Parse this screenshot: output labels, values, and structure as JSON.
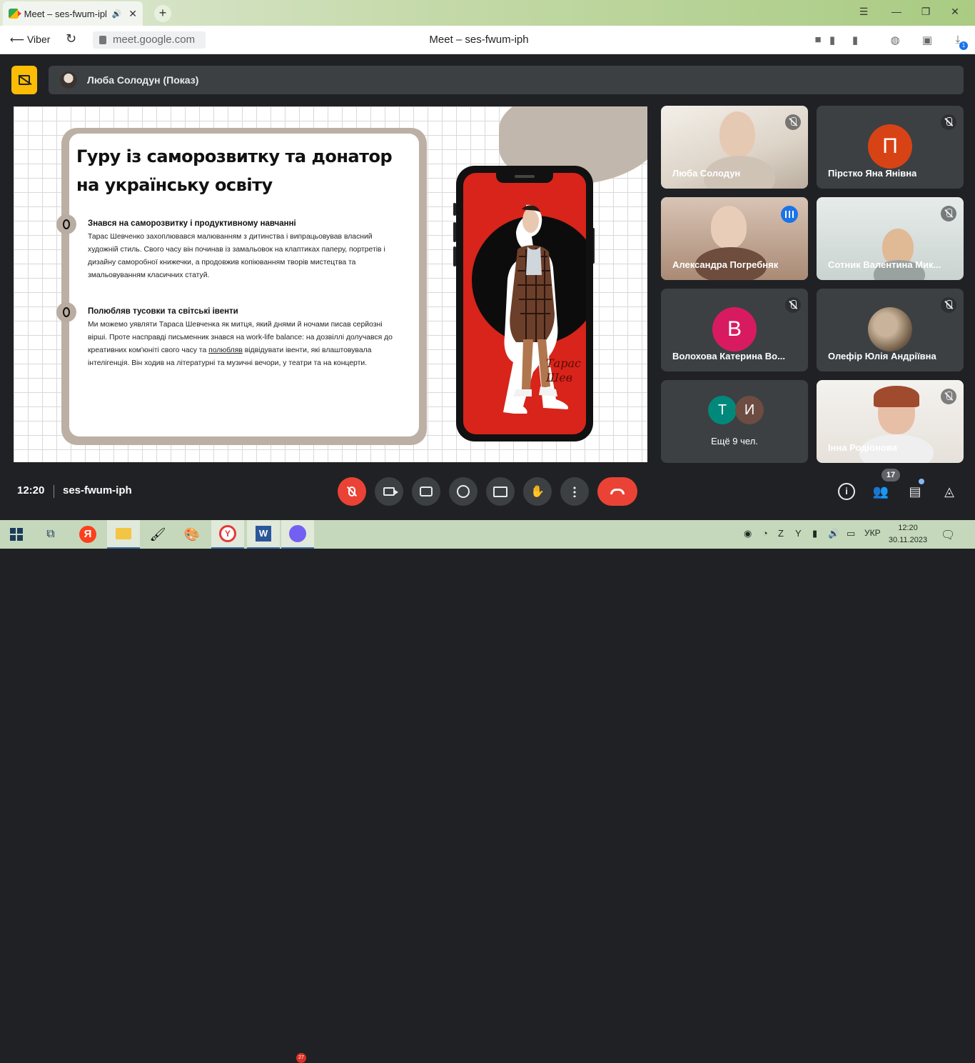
{
  "browser": {
    "tab_title": "Meet – ses-fwum-iph",
    "back_label": "Viber",
    "url": "meet.google.com",
    "page_title": "Meet – ses-fwum-iph",
    "downloads_badge": "1"
  },
  "presenter": {
    "name": "Люба Солодун (Показ)"
  },
  "slide": {
    "title": "Гуру із саморозвитку та донатор на українську освіту",
    "sections": [
      {
        "heading": "Знався на саморозвитку і продуктивному навчанні",
        "text": "Тарас Шевченко захоплювався малюванням з дитинства і випрацьовував власний художній стиль. Свого часу він починав із замальовок на клаптиках паперу, портретів і дизайну саморобної книжечки, а продовжив копіюванням творів мистецтва та змальовуванням класичних статуй."
      },
      {
        "heading": "Полюбляв тусовки та світські івенти",
        "text_before": "Ми можемо уявляти Тараса Шевченка як митця, який днями й ночами писав серйозні вірші. Проте насправді письменник знався на work-life balance: на дозвіллі долучався до креативних ком'юніті свого часу та ",
        "text_underlined": "полюбляв",
        "text_after": " відвідувати івенти, які влаштовувала інтелігенція. Він ходив на літературні та музичні вечори, у театри та на концерти."
      }
    ],
    "signature_line1": "Тарас",
    "signature_line2": "Шев"
  },
  "participants": [
    {
      "name": "Люба Солодун",
      "type": "video",
      "muted": true
    },
    {
      "name": "Пірстко Яна Янівна",
      "type": "avatar",
      "initial": "П",
      "color": "#d84315",
      "muted": true
    },
    {
      "name": "Александра Погребняк",
      "type": "video",
      "speaking": true
    },
    {
      "name": "Сотник Валентина Мик...",
      "type": "video",
      "muted": true
    },
    {
      "name": "Волохова Катерина Во...",
      "type": "avatar",
      "initial": "В",
      "color": "#d81b60",
      "muted": true
    },
    {
      "name": "Олефір Юлія Андріївна",
      "type": "photo",
      "muted": true
    },
    {
      "name": "Ещё 9 чел.",
      "type": "more",
      "initials": [
        "Т",
        "И"
      ],
      "colors": [
        "#00897b",
        "#6d4c41"
      ]
    },
    {
      "name": "Інна Родіонова",
      "type": "video",
      "muted": true
    }
  ],
  "controls": {
    "time": "12:20",
    "meeting_code": "ses-fwum-iph",
    "people_count": "17",
    "info_icon_glyph": "i"
  },
  "taskbar": {
    "lang": "УКР",
    "time": "12:20",
    "date": "30.11.2023",
    "viber_badge": "27"
  }
}
